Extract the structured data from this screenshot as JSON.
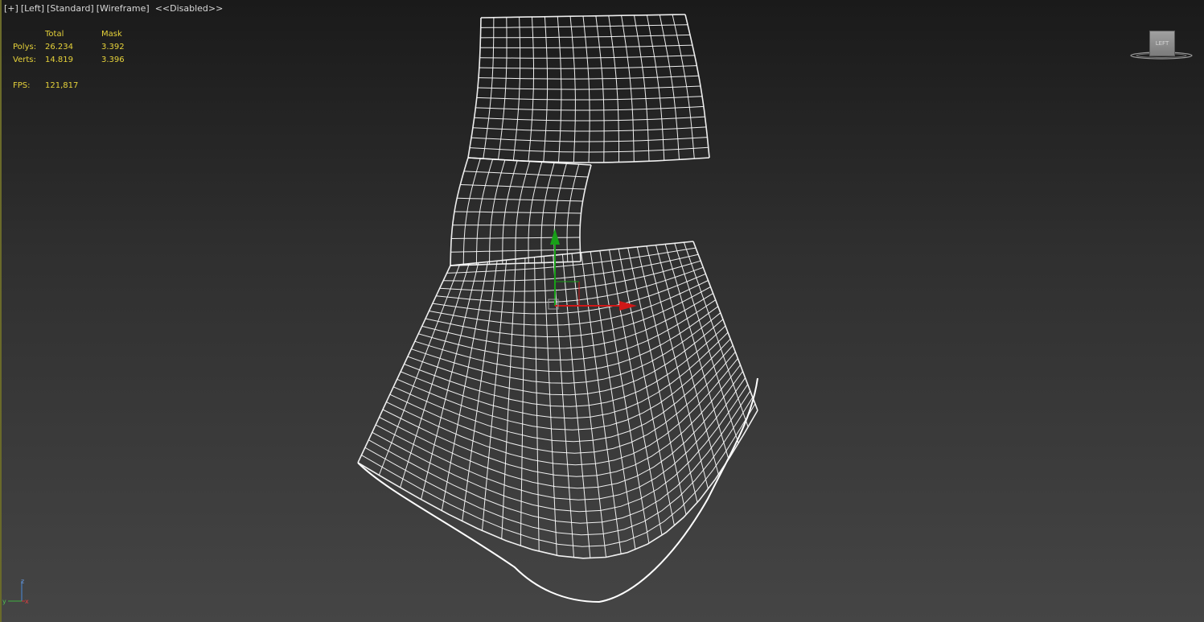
{
  "viewport": {
    "labels": {
      "plus": "[+]",
      "view": "[Left]",
      "shading_std": "[Standard]",
      "shading_wire": "[Wireframe]",
      "disabled": "<<Disabled>>"
    }
  },
  "stats": {
    "header_total": "Total",
    "header_mask": "Mask",
    "polys_label": "Polys:",
    "polys_total": "26.234",
    "polys_mask": "3.392",
    "verts_label": "Verts:",
    "verts_total": "14.819",
    "verts_mask": "3.396",
    "fps_label": "FPS:",
    "fps_value": "121,817"
  },
  "viewcube": {
    "face_label": "LEFT"
  },
  "axis": {
    "z": "z",
    "y": "y",
    "x": "x"
  },
  "colors": {
    "wire": "#ffffff",
    "stats": "#e6d23a",
    "gizmo_x": "#d01818",
    "gizmo_y": "#18a018"
  },
  "icons": [
    "transform-gizmo-icon",
    "axis-tripod-icon",
    "viewcube-icon"
  ]
}
